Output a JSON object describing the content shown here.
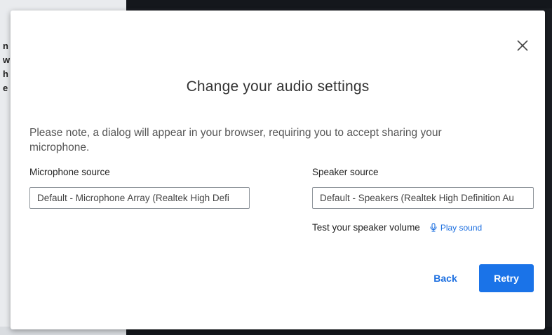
{
  "background": {
    "snippets": [
      "n",
      "w",
      "h",
      "e"
    ]
  },
  "dialog": {
    "title": "Change your audio settings",
    "note": "Please note, a dialog will appear in your browser, requiring you to accept sharing your microphone.",
    "close_icon": "close-icon",
    "microphone": {
      "label": "Microphone source",
      "value": "Default - Microphone Array (Realtek High Defi"
    },
    "speaker": {
      "label": "Speaker source",
      "value": "Default - Speakers (Realtek High Definition Au"
    },
    "test": {
      "label": "Test your speaker volume",
      "play_label": "Play sound",
      "play_icon": "microphone-icon"
    },
    "buttons": {
      "back": "Back",
      "retry": "Retry"
    }
  },
  "colors": {
    "accent": "#1a73e8",
    "link": "#1c6fe0"
  }
}
